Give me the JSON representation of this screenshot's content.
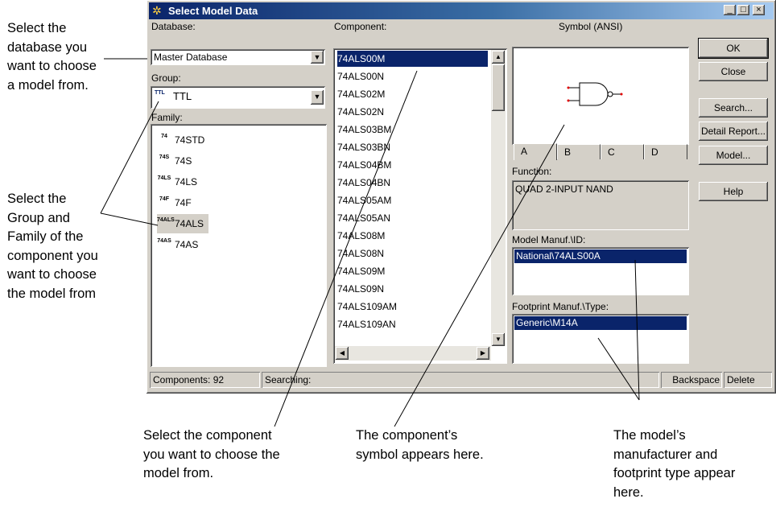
{
  "annotations": {
    "database": "Select the\ndatabase you\nwant to choose\na model from.",
    "group_family": "Select the\nGroup and\nFamily of the\ncomponent you\nwant to choose\nthe model from",
    "component": "Select the component\nyou want to choose the\nmodel from.",
    "symbol": "The component’s\nsymbol appears here.",
    "manufacturer": "The model’s\nmanufacturer and\nfootprint type appear\nhere."
  },
  "dialog": {
    "title": "Select Model Data",
    "title_controls": [
      "_",
      "□",
      "×"
    ]
  },
  "database": {
    "label": "Database:",
    "value": "Master Database"
  },
  "group": {
    "label": "Group:",
    "value": "TTL",
    "icon_text": "TTL"
  },
  "family": {
    "label": "Family:",
    "items": [
      {
        "label": "74STD",
        "icon": "74"
      },
      {
        "label": "74S",
        "icon": "74S"
      },
      {
        "label": "74LS",
        "icon": "74LS"
      },
      {
        "label": "74F",
        "icon": "74F"
      },
      {
        "label": "74ALS",
        "icon": "74ALS"
      },
      {
        "label": "74AS",
        "icon": "74AS"
      }
    ],
    "selected": "74ALS"
  },
  "component": {
    "label": "Component:",
    "items": [
      "74ALS00M",
      "74ALS00N",
      "74ALS02M",
      "74ALS02N",
      "74ALS03BM",
      "74ALS03BN",
      "74ALS04BM",
      "74ALS04BN",
      "74ALS05AM",
      "74ALS05AN",
      "74ALS08M",
      "74ALS08N",
      "74ALS09M",
      "74ALS09N",
      "74ALS109AM",
      "74ALS109AN"
    ],
    "selected": "74ALS00M"
  },
  "symbol": {
    "label": "Symbol (ANSI)",
    "tabs": [
      "A",
      "B",
      "C",
      "D"
    ],
    "active_tab": "A"
  },
  "function": {
    "label": "Function:",
    "value": "QUAD 2-INPUT NAND"
  },
  "model_manuf": {
    "label": "Model Manuf.\\ID:",
    "value": "National\\74ALS00A"
  },
  "footprint": {
    "label": "Footprint Manuf.\\Type:",
    "value": "Generic\\M14A"
  },
  "buttons": {
    "ok": "OK",
    "close": "Close",
    "search": "Search...",
    "detail": "Detail Report...",
    "model": "Model...",
    "help": "Help"
  },
  "status": {
    "components": "Components: 92",
    "searching": "Searching:",
    "backspace": "Backspace",
    "delete": "Delete"
  },
  "colors": {
    "title_start": "#0a246a",
    "title_end": "#a6caf0",
    "selection": "#0a246a",
    "face": "#d4d0c8"
  }
}
